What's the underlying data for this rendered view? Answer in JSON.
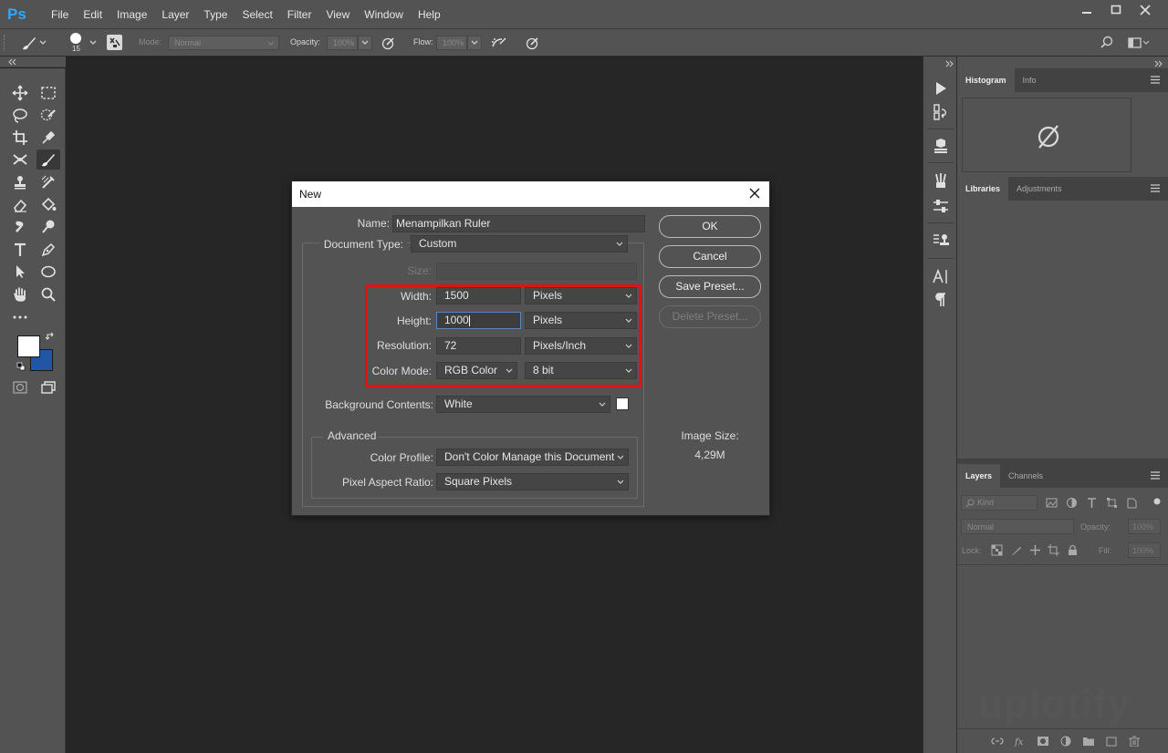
{
  "app": {
    "logo": "Ps"
  },
  "menu": [
    "File",
    "Edit",
    "Image",
    "Layer",
    "Type",
    "Select",
    "Filter",
    "View",
    "Window",
    "Help"
  ],
  "options_bar": {
    "brush_size": "15",
    "mode_label": "Mode:",
    "mode_value": "Normal",
    "opacity_label": "Opacity:",
    "opacity_value": "100%",
    "flow_label": "Flow:",
    "flow_value": "100%"
  },
  "panels": {
    "histogram_tab": "Histogram",
    "info_tab": "Info",
    "libraries_tab": "Libraries",
    "adjustments_tab": "Adjustments",
    "layers_tab": "Layers",
    "channels_tab": "Channels",
    "kind_placeholder": "Kind",
    "blend_mode": "Normal",
    "opacity_label": "Opacity:",
    "opacity_value": "100%",
    "lock_label": "Lock:",
    "fill_label": "Fill:",
    "fill_value": "100%"
  },
  "dialog": {
    "title": "New",
    "name_label": "Name:",
    "name_value": "Menampilkan Ruler",
    "doc_type_label": "Document Type:",
    "doc_type_value": "Custom",
    "size_label": "Size:",
    "width_label": "Width:",
    "width_value": "1500",
    "width_unit": "Pixels",
    "height_label": "Height:",
    "height_value": "1000",
    "height_unit": "Pixels",
    "resolution_label": "Resolution:",
    "resolution_value": "72",
    "resolution_unit": "Pixels/Inch",
    "color_mode_label": "Color Mode:",
    "color_mode_value": "RGB Color",
    "bit_depth_value": "8 bit",
    "background_label": "Background Contents:",
    "background_value": "White",
    "advanced_label": "Advanced",
    "color_profile_label": "Color Profile:",
    "color_profile_value": "Don't Color Manage this Document",
    "pixel_aspect_label": "Pixel Aspect Ratio:",
    "pixel_aspect_value": "Square Pixels",
    "ok_label": "OK",
    "cancel_label": "Cancel",
    "save_preset_label": "Save Preset...",
    "delete_preset_label": "Delete Preset...",
    "image_size_label": "Image Size:",
    "image_size_value": "4,29M"
  },
  "watermark": "uplotify",
  "colors": {
    "foreground": "#ffffff",
    "background": "#2355a6",
    "highlight": "#e21212"
  }
}
